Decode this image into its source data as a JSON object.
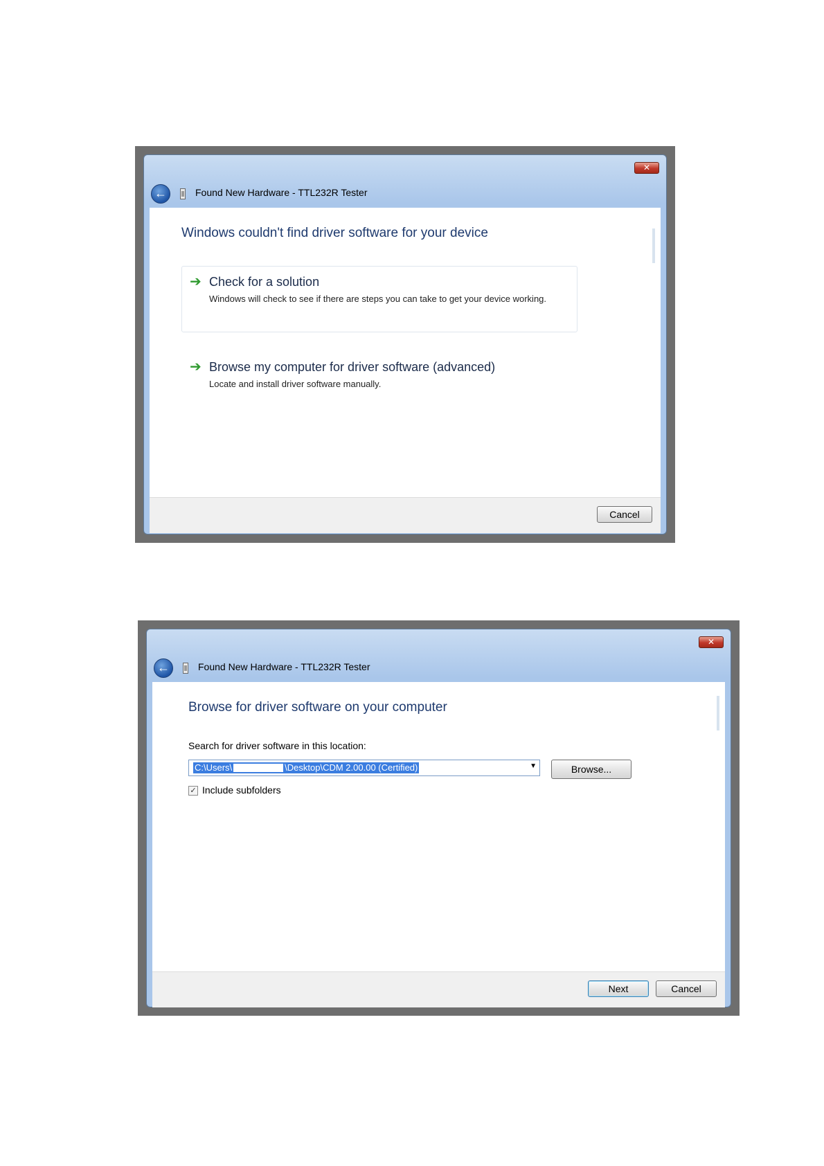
{
  "dialog1": {
    "title": "Found New Hardware - TTL232R Tester",
    "close_glyph": "✕",
    "heading": "Windows couldn't find driver software for your device",
    "options": [
      {
        "title": "Check for a solution",
        "description": "Windows will check to see if there are steps you can take to get your device working."
      },
      {
        "title": "Browse my computer for driver software (advanced)",
        "description": "Locate and install driver software manually."
      }
    ],
    "arrow_glyph": "➔",
    "cancel_label": "Cancel"
  },
  "dialog2": {
    "title": "Found New Hardware - TTL232R Tester",
    "close_glyph": "✕",
    "heading": "Browse for driver software on your computer",
    "search_label": "Search for driver software in this location:",
    "path_prefix": "C:\\Users\\",
    "path_suffix": "\\Desktop\\CDM 2.00.00 (Certified)",
    "browse_label": "Browse...",
    "include_subfolders_label": "Include subfolders",
    "include_subfolders_checked": true,
    "check_glyph": "✓",
    "next_label": "Next",
    "cancel_label": "Cancel"
  },
  "icons": {
    "back": "back-arrow-icon",
    "hardware": "usb-device-icon",
    "close": "close-icon",
    "option_arrow": "green-arrow-icon",
    "dropdown": "chevron-down-icon"
  },
  "colors": {
    "title_bar": "#a9c6ea",
    "heading_text": "#1e3a6e",
    "close_button": "#c0392b",
    "option_arrow": "#2f9a2f",
    "selection": "#3b7de0"
  }
}
